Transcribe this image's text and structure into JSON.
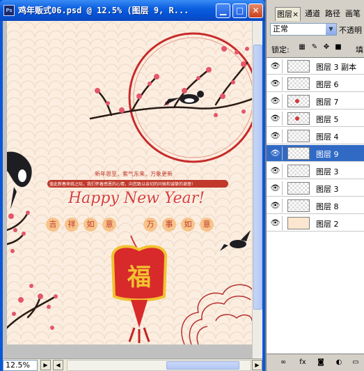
{
  "document": {
    "title": "鸡年贩式06.psd @ 12.5% (图层 9, R...",
    "app_icon": "Ps",
    "zoom": "12.5%"
  },
  "artwork": {
    "banner_line1": "新年恩至，紫气东来，万象更新",
    "banner_line2": "值此新春来临之际，我们怀着感恩的心情，向您致以亲切的问候和诚挚的谢意!",
    "happy_new_year": "Happy New Year!",
    "seals_left": [
      "吉",
      "祥",
      "如",
      "意"
    ],
    "seals_right": [
      "万",
      "事",
      "如",
      "意"
    ],
    "fu_char": "福"
  },
  "panel": {
    "tabs": [
      {
        "label": "图层",
        "active": true,
        "close": "×"
      },
      {
        "label": "通道",
        "active": false
      },
      {
        "label": "路径",
        "active": false
      },
      {
        "label": "画笔",
        "active": false
      }
    ],
    "blend_mode": "正常",
    "opacity_label": "不透明",
    "lock_label": "锁定:",
    "fill_label": "填",
    "layers": [
      {
        "name": "图层 3 副本",
        "visible": true,
        "selected": false,
        "thumb": "transparent"
      },
      {
        "name": "图层 6",
        "visible": true,
        "selected": false,
        "thumb": "transparent"
      },
      {
        "name": "图层 7",
        "visible": true,
        "selected": false,
        "thumb": "dot"
      },
      {
        "name": "图层 5",
        "visible": true,
        "selected": false,
        "thumb": "dot"
      },
      {
        "name": "图层 4",
        "visible": true,
        "selected": false,
        "thumb": "transparent"
      },
      {
        "name": "图层 9",
        "visible": true,
        "selected": true,
        "thumb": "transparent"
      },
      {
        "name": "图层 3",
        "visible": true,
        "selected": false,
        "thumb": "transparent"
      },
      {
        "name": "图层 3",
        "visible": true,
        "selected": false,
        "thumb": "transparent"
      },
      {
        "name": "图层 8",
        "visible": true,
        "selected": false,
        "thumb": "transparent"
      },
      {
        "name": "图层 2",
        "visible": true,
        "selected": false,
        "thumb": "bg"
      }
    ]
  },
  "colors": {
    "titlebar": "#0553d4",
    "selection": "#316ac5",
    "accent_red": "#d23a3a",
    "gold": "#f2c230"
  }
}
